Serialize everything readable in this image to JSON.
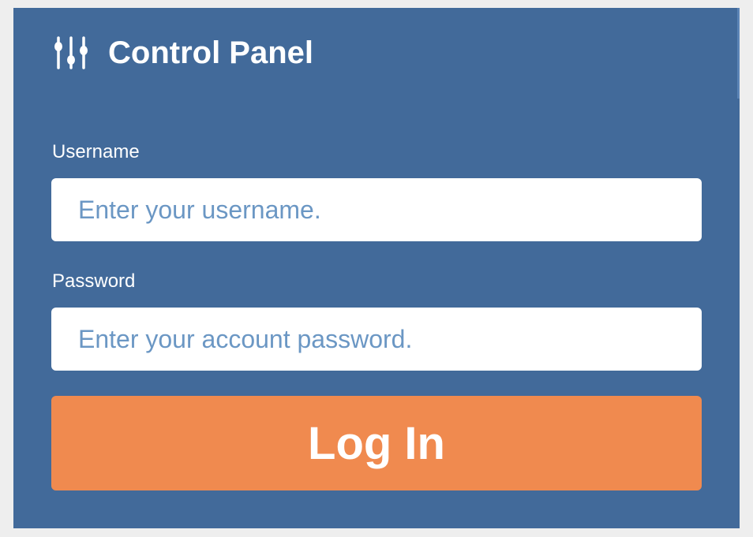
{
  "header": {
    "icon": "sliders-icon",
    "title": "Control Panel"
  },
  "form": {
    "username": {
      "label": "Username",
      "value": "",
      "placeholder": "Enter your username."
    },
    "password": {
      "label": "Password",
      "value": "",
      "placeholder": "Enter your account password."
    },
    "submit_label": "Log In"
  },
  "colors": {
    "page_background": "#eeeeee",
    "panel_background": "#426a9a",
    "placeholder_text": "#6b97c4",
    "button_background": "#f08a4f",
    "text_on_panel": "#ffffff"
  }
}
